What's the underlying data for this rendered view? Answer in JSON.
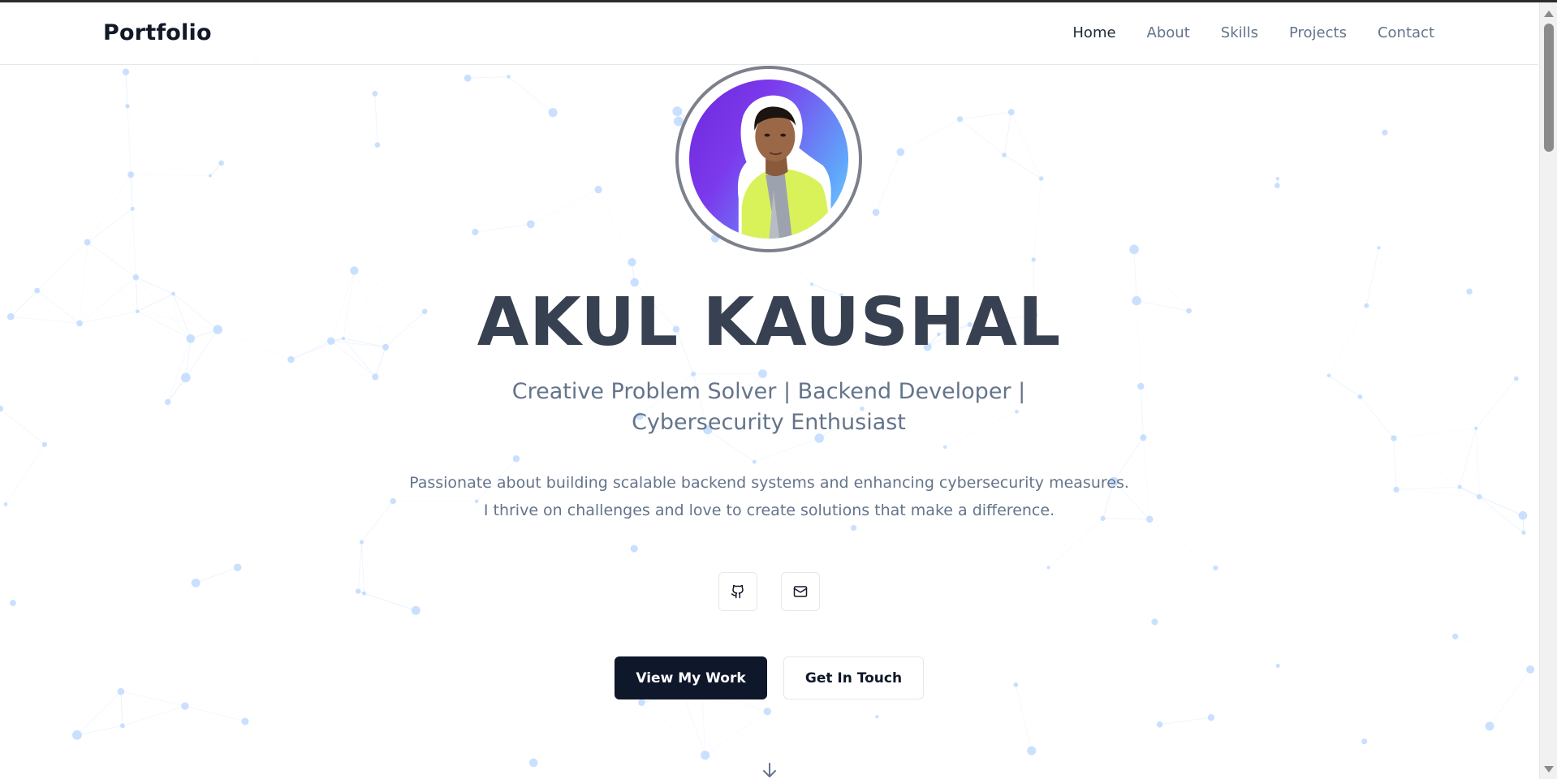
{
  "navbar": {
    "brand": "Portfolio",
    "links": [
      {
        "label": "Home",
        "active": true
      },
      {
        "label": "About",
        "active": false
      },
      {
        "label": "Skills",
        "active": false
      },
      {
        "label": "Projects",
        "active": false
      },
      {
        "label": "Contact",
        "active": false
      }
    ]
  },
  "hero": {
    "name": "AKUL KAUSHAL",
    "subtitle": "Creative Problem Solver | Backend Developer | Cybersecurity Enthusiast",
    "description": "Passionate about building scalable backend systems and enhancing cybersecurity measures. I thrive on challenges and love to create solutions that make a difference.",
    "social": [
      {
        "icon": "github-icon"
      },
      {
        "icon": "mail-icon"
      }
    ],
    "primary_button": "View My Work",
    "secondary_button": "Get In Touch",
    "scroll_icon": "arrow-down-icon"
  },
  "colors": {
    "primary": "#0f172a",
    "heading": "#374151",
    "muted": "#64748b",
    "network_node": "#bfdbfe",
    "network_line": "#dbeafe",
    "avatar_gradient_start": "#6d28d9",
    "avatar_gradient_end": "#7dd3fc"
  }
}
